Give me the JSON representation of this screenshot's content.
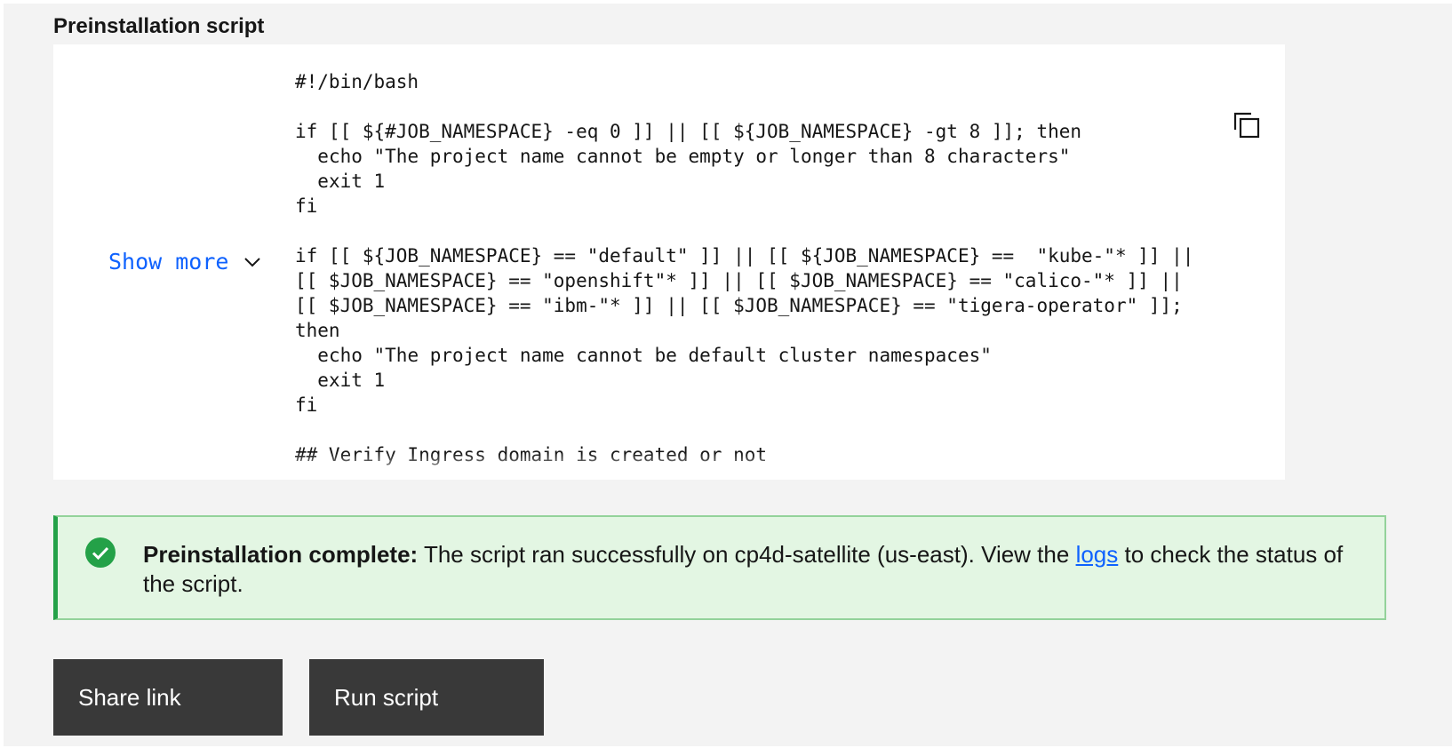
{
  "section": {
    "title": "Preinstallation script"
  },
  "code_panel": {
    "show_more_label": "Show more",
    "copy_icon": "copy-icon",
    "chevron_icon": "chevron-down-icon",
    "code": "#!/bin/bash\n\nif [[ ${#JOB_NAMESPACE} -eq 0 ]] || [[ ${JOB_NAMESPACE} -gt 8 ]]; then\n  echo \"The project name cannot be empty or longer than 8 characters\"\n  exit 1\nfi\n\nif [[ ${JOB_NAMESPACE} == \"default\" ]] || [[ ${JOB_NAMESPACE} ==  \"kube-\"* ]] || [[ $JOB_NAMESPACE} == \"openshift\"* ]] || [[ $JOB_NAMESPACE} == \"calico-\"* ]] || [[ $JOB_NAMESPACE} == \"ibm-\"* ]] || [[ $JOB_NAMESPACE} == \"tigera-operator\" ]]; then\n  echo \"The project name cannot be default cluster namespaces\"\n  exit 1\nfi\n\n## Verify Ingress domain is created or not"
  },
  "notification": {
    "kind": "success",
    "icon": "checkmark-filled-icon",
    "title": "Preinstallation complete:",
    "message_before_link": " The script ran successfully on cp4d-satellite (us-east). View the ",
    "link_text": "logs",
    "message_after_link": " to check the status of the script.",
    "colors": {
      "background": "#e3f6e3",
      "border": "#93d29a",
      "accent": "#24a148"
    }
  },
  "actions": {
    "share_label": "Share link",
    "run_label": "Run script"
  },
  "colors": {
    "link": "#0f62fe",
    "button_bg": "#393939",
    "page_bg": "#f3f3f3"
  }
}
